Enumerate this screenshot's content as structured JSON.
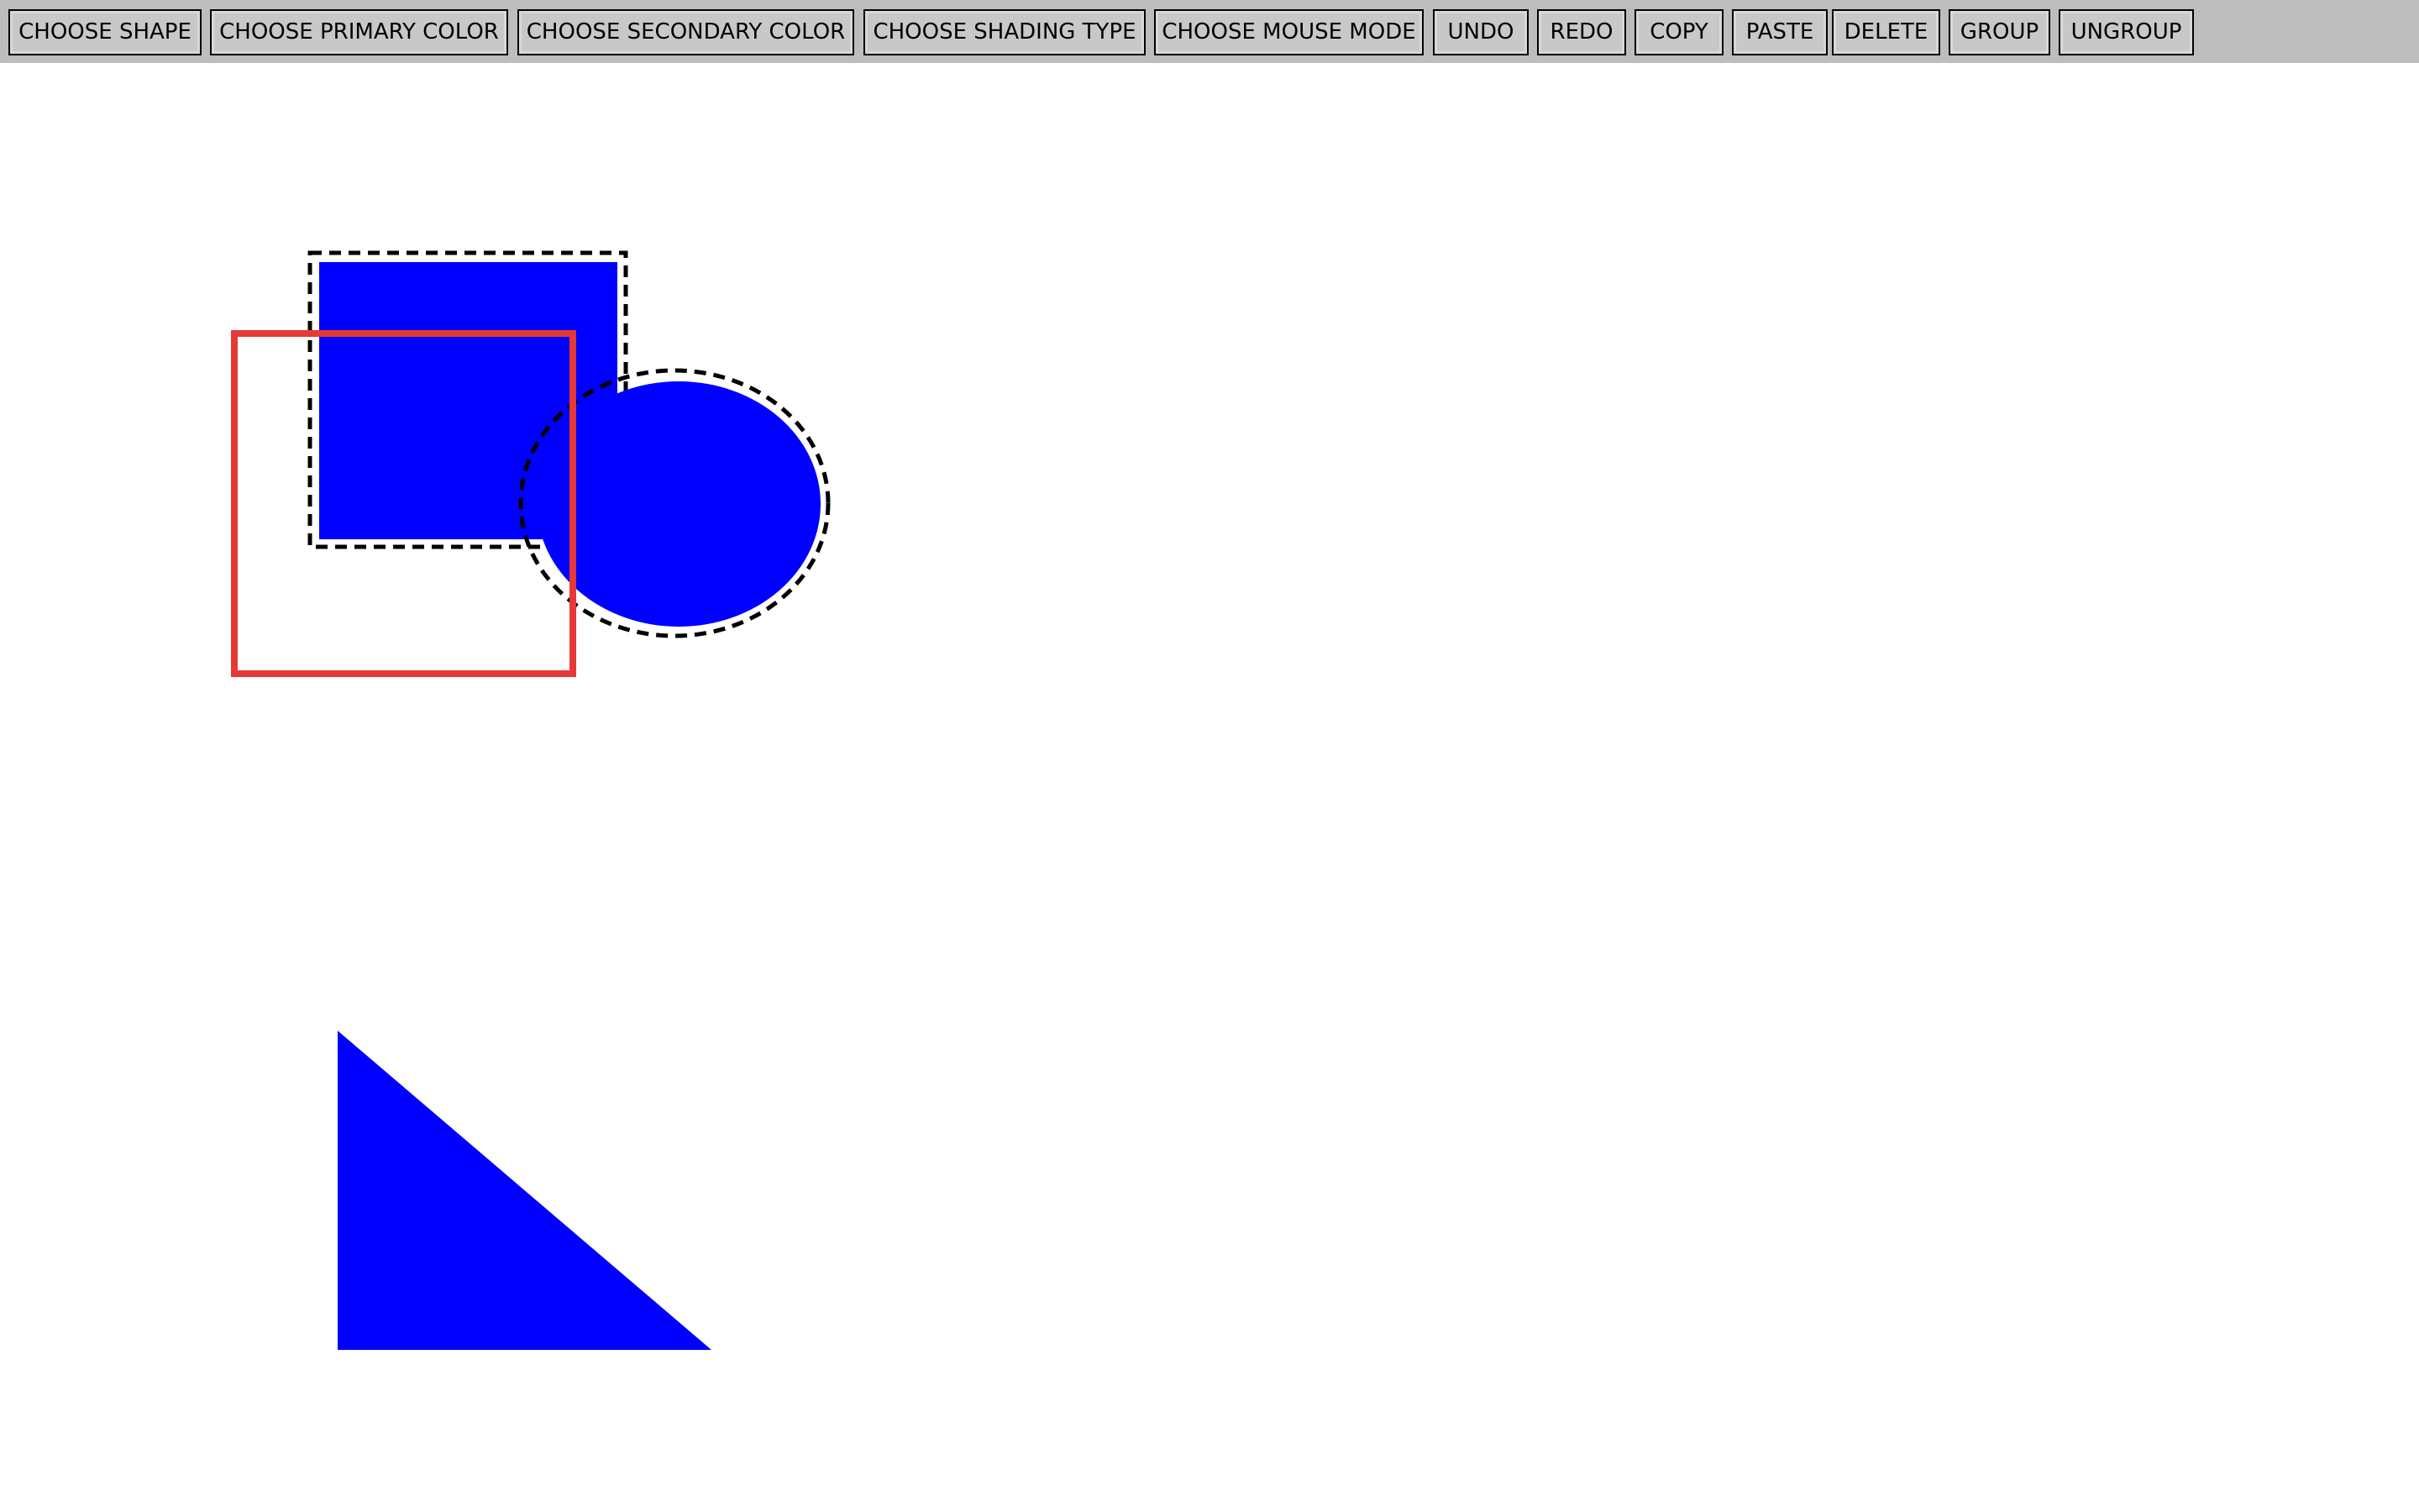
{
  "toolbar": {
    "buttons": [
      {
        "label": "CHOOSE SHAPE"
      },
      {
        "label": "CHOOSE PRIMARY COLOR"
      },
      {
        "label": "CHOOSE SECONDARY COLOR"
      },
      {
        "label": "CHOOSE SHADING TYPE"
      },
      {
        "label": "CHOOSE MOUSE MODE"
      },
      {
        "label": "UNDO"
      },
      {
        "label": "REDO"
      },
      {
        "label": "COPY"
      },
      {
        "label": "PASTE"
      },
      {
        "label": "DELETE"
      },
      {
        "label": "GROUP"
      },
      {
        "label": "UNGROUP"
      }
    ]
  },
  "canvas": {
    "shapes": [
      {
        "kind": "rectangle",
        "fill": "#0000ff",
        "selected": true
      },
      {
        "kind": "ellipse",
        "fill": "#0000ff",
        "selected": true
      },
      {
        "kind": "rectangle",
        "outline": "#e53935",
        "fill": "none",
        "selected": false
      },
      {
        "kind": "triangle",
        "fill": "#0000ff",
        "selected": false
      }
    ],
    "selection_outline_color": "#000000",
    "background": "#ffffff"
  }
}
